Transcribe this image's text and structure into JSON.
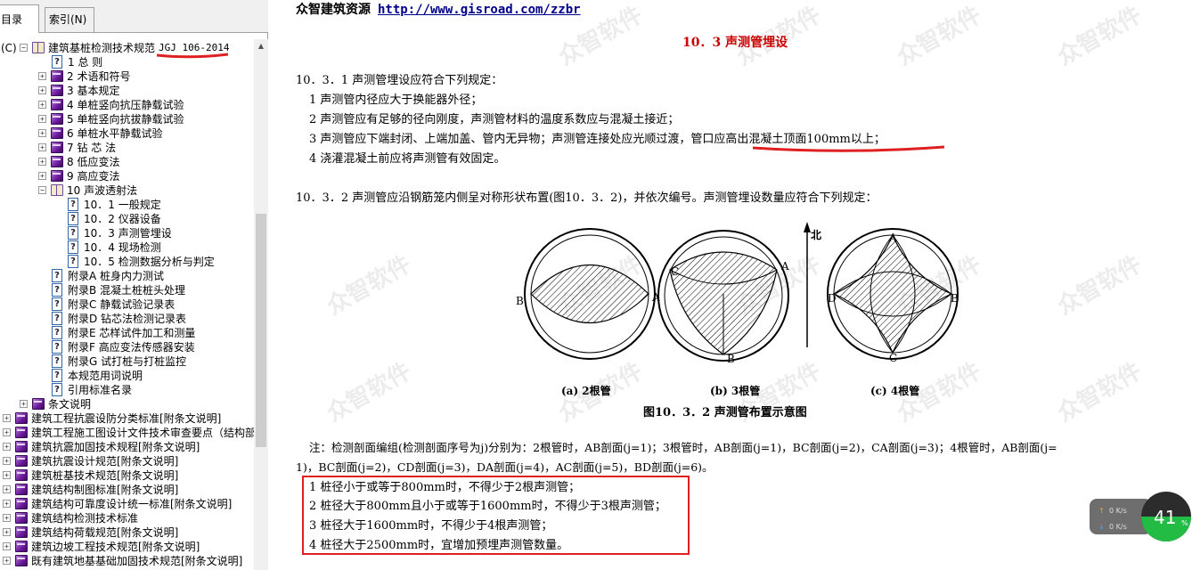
{
  "tabs": {
    "contents": "目录(C)",
    "index": "索引(N)"
  },
  "tree": [
    {
      "label": "建筑基桩检测技术规范",
      "code": "JGJ 106-2014"
    },
    {
      "label": "1 总 则"
    },
    {
      "label": "2 术语和符号"
    },
    {
      "label": "3 基本规定"
    },
    {
      "label": "4 单桩竖向抗压静载试验"
    },
    {
      "label": "5 单桩竖向抗拔静载试验"
    },
    {
      "label": "6 单桩水平静载试验"
    },
    {
      "label": "7 钻 芯 法"
    },
    {
      "label": "8 低应变法"
    },
    {
      "label": "9 高应变法"
    },
    {
      "label": "10 声波透射法"
    },
    {
      "label": "10．1 一般规定"
    },
    {
      "label": "10．2 仪器设备"
    },
    {
      "label": "10．3 声测管埋设"
    },
    {
      "label": "10．4 现场检测"
    },
    {
      "label": "10．5 检测数据分析与判定"
    },
    {
      "label": "附录A 桩身内力测试"
    },
    {
      "label": "附录B 混凝土桩桩头处理"
    },
    {
      "label": "附录C 静载试验记录表"
    },
    {
      "label": "附录D 钻芯法检测记录表"
    },
    {
      "label": "附录E 芯样试件加工和测量"
    },
    {
      "label": "附录F 高应变法传感器安装"
    },
    {
      "label": "附录G 试打桩与打桩监控"
    },
    {
      "label": "本规范用词说明"
    },
    {
      "label": "引用标准名录"
    },
    {
      "label": "条文说明"
    },
    {
      "label": "建筑工程抗震设防分类标准[附条文说明]"
    },
    {
      "label": "建筑工程施工图设计文件技术审查要点（结构部"
    },
    {
      "label": "建筑抗震加固技术规程[附条文说明]"
    },
    {
      "label": "建筑抗震设计规范[附条文说明]"
    },
    {
      "label": "建筑桩基技术规范[附条文说明]"
    },
    {
      "label": "建筑结构制图标准[附条文说明]"
    },
    {
      "label": "建筑结构可靠度设计统一标准[附条文说明]"
    },
    {
      "label": "建筑结构检测技术标准"
    },
    {
      "label": "建筑结构荷载规范[附条文说明]"
    },
    {
      "label": "建筑边坡工程技术规范[附条文说明]"
    },
    {
      "label": "既有建筑地基基础加固技术规范[附条文说明]"
    }
  ],
  "content": {
    "source_label": "众智建筑资源",
    "source_url": "http://www.gisroad.com/zzbr",
    "heading": "10．3 声测管埋设",
    "s1": "10．3．1 声测管埋设应符合下列规定：",
    "s1_items": [
      "1 声测管内径应大于换能器外径；",
      "2 声测管应有足够的径向刚度，声测管材料的温度系数应与混凝土接近；",
      "3 声测管应下端封闭、上端加盖、管内无异物；声测管连接处应光顺过渡，管口应高出混凝土顶面100mm以上；",
      "4 浇灌混凝土前应将声测管有效固定。"
    ],
    "s2": "10．3．2 声测管应沿钢筋笼内侧呈对称形状布置(图10．3．2)，并依次编号。声测管埋设数量应符合下列规定：",
    "fig": {
      "north": "北",
      "a": "(a) 2根管",
      "b": "(b) 3根管",
      "c": "(c) 4根管",
      "title": "图10．3．2 声测管布置示意图",
      "letters": {
        "A": "A",
        "B": "B",
        "C": "C",
        "D": "D"
      }
    },
    "note1": "注：检测剖面编组(检测剖面序号为j)分别为：2根管时，AB剖面(j=1)；3根管时，AB剖面(j=1)，BC剖面(j=2)，CA剖面(j=3)；4根管时，AB剖面(j=",
    "note2": "1)，BC剖面(j=2)，CD剖面(j=3)，DA剖面(j=4)，AC剖面(j=5)，BD剖面(j=6)。",
    "rules": [
      "1 桩径小于或等于800mm时，不得少于2根声测管；",
      "2 桩径大于800mm且小于或等于1600mm时，不得少于3根声测管；",
      "3 桩径大于1600mm时，不得少于4根声测管；",
      "4 桩径大于2500mm时，宜增加预埋声测管数量。"
    ],
    "watermark": "众智软件"
  },
  "network": {
    "up": "0 K/s",
    "down": "0 K/s",
    "percent": "41",
    "pct_sign": "%"
  },
  "colors": {
    "heading": "#c00000",
    "link": "#00008b",
    "annotation": "#e02020",
    "gauge": "#22bb44"
  }
}
